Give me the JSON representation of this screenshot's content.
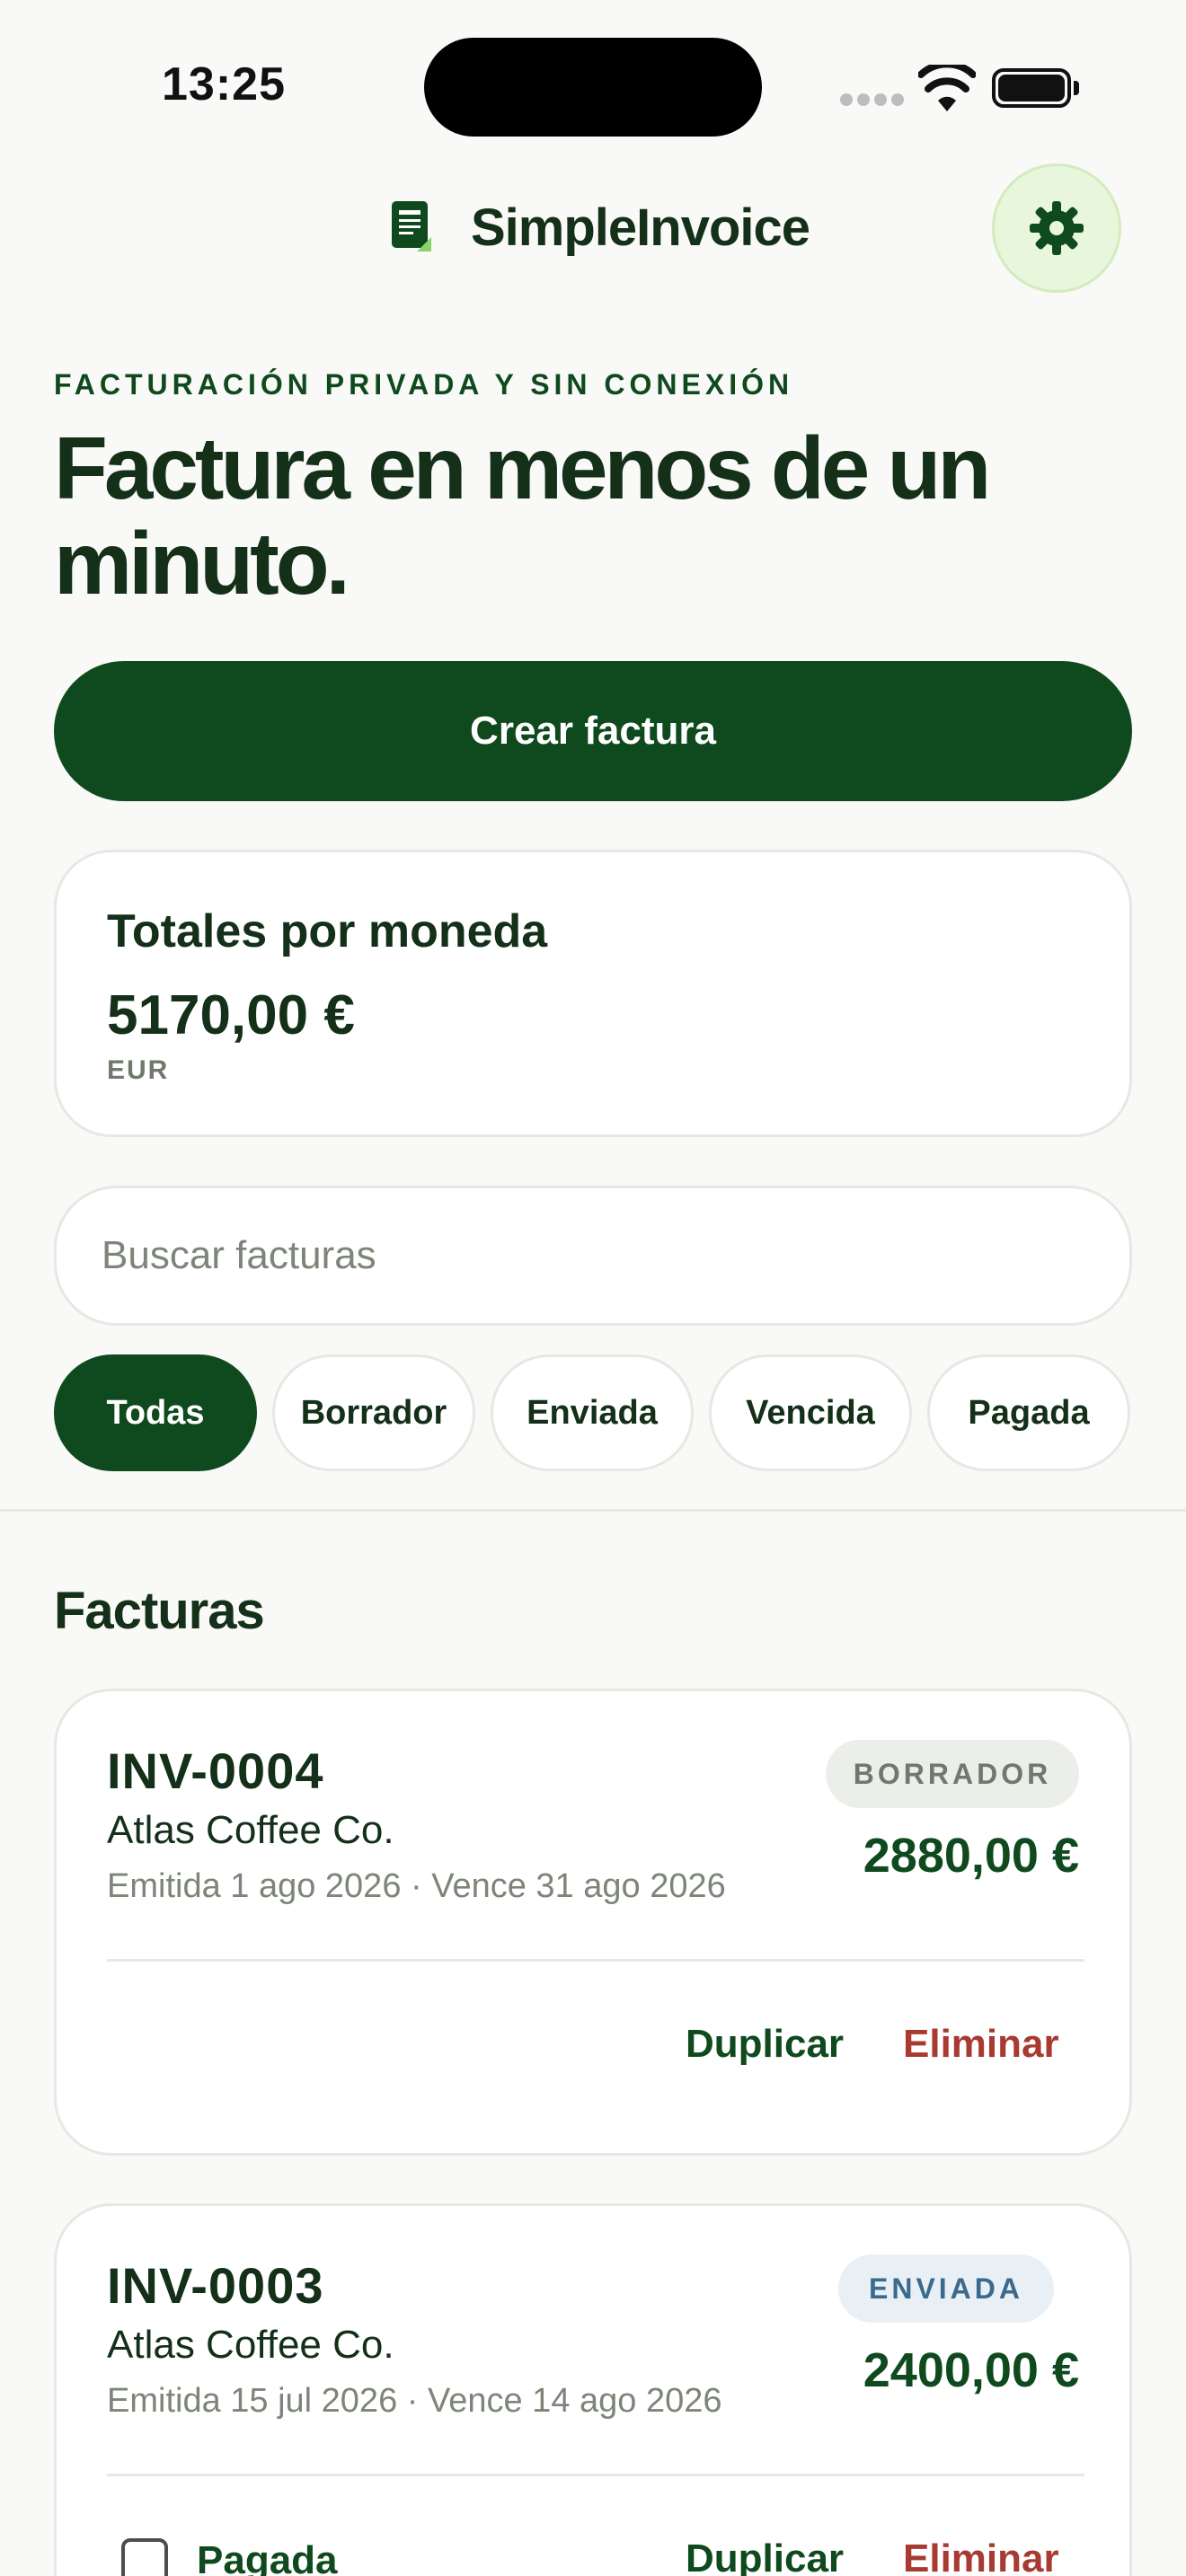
{
  "status_bar": {
    "time": "13:25"
  },
  "header": {
    "app_name": "SimpleInvoice"
  },
  "hero": {
    "eyebrow": "FACTURACIÓN PRIVADA Y SIN CONEXIÓN",
    "headline": "Factura en menos de un minuto.",
    "create_label": "Crear factura"
  },
  "totals": {
    "title": "Totales por moneda",
    "amount": "5170,00 €",
    "currency": "EUR"
  },
  "search": {
    "placeholder": "Buscar facturas",
    "value": ""
  },
  "filters": [
    "Todas",
    "Borrador",
    "Enviada",
    "Vencida",
    "Pagada"
  ],
  "filters_active": "Todas",
  "invoices_section": {
    "title": "Facturas"
  },
  "invoices": [
    {
      "number": "INV-0004",
      "client": "Atlas Coffee Co.",
      "dates": "Emitida 1 ago 2026 · Vence 31 ago 2026",
      "status": "BORRADOR",
      "amount": "2880,00 €",
      "duplicate_label": "Duplicar",
      "delete_label": "Eliminar"
    },
    {
      "number": "INV-0003",
      "client": "Atlas Coffee Co.",
      "dates": "Emitida 15 jul 2026 · Vence 14 ago 2026",
      "status": "ENVIADA",
      "amount": "2400,00 €",
      "paid_label": "Pagada",
      "duplicate_label": "Duplicar",
      "delete_label": "Eliminar"
    }
  ],
  "colors": {
    "brand": "#0f4a1e",
    "danger": "#a83a32",
    "background": "#f9f9f7",
    "settings_bg": "#e8f7dc"
  },
  "icons": [
    "wifi-icon",
    "battery-icon",
    "document-icon",
    "gear-icon",
    "checkbox-icon"
  ]
}
